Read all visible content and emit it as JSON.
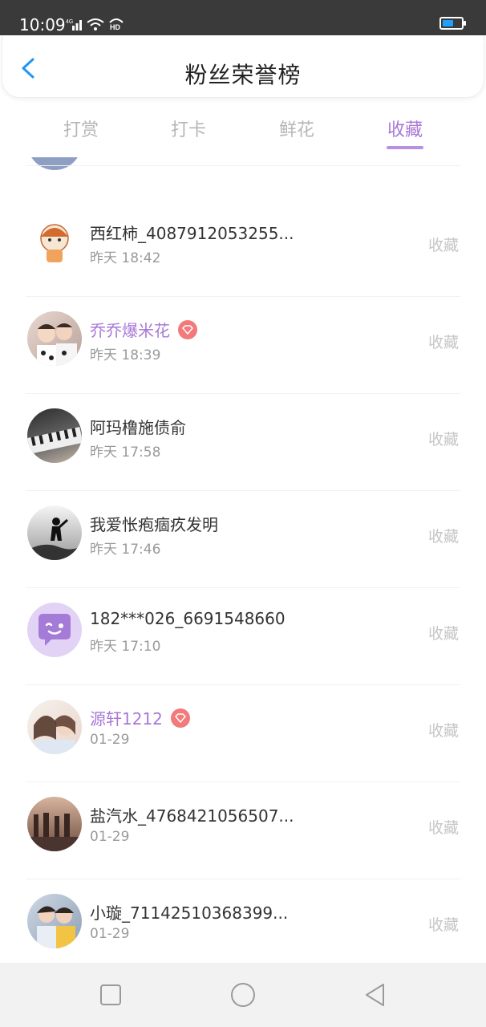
{
  "status": {
    "time": "10:09",
    "network": "4G",
    "hd": "HD"
  },
  "header": {
    "title": "粉丝荣誉榜"
  },
  "tabs": [
    "打赏",
    "打卡",
    "鲜花",
    "收藏"
  ],
  "active_tab": "收藏",
  "rows": [
    {
      "name": "西红柿_4087912053255...",
      "time": "昨天 18:42",
      "action": "收藏",
      "vip": false
    },
    {
      "name": "乔乔爆米花",
      "time": "昨天 18:39",
      "action": "收藏",
      "vip": true
    },
    {
      "name": "阿玛橹施债俞",
      "time": "昨天 17:58",
      "action": "收藏",
      "vip": false
    },
    {
      "name": "我爱怅疱痼疚发明",
      "time": "昨天 17:46",
      "action": "收藏",
      "vip": false
    },
    {
      "name": "182***026_6691548660",
      "time": "昨天 17:10",
      "action": "收藏",
      "vip": false
    },
    {
      "name": "源轩1212",
      "time": "01-29",
      "action": "收藏",
      "vip": true
    },
    {
      "name": "盐汽水_4768421056507...",
      "time": "01-29",
      "action": "收藏",
      "vip": false
    },
    {
      "name": "小璇_71142510368399...",
      "time": "01-29",
      "action": "收藏",
      "vip": false
    }
  ],
  "colors": {
    "accent": "#a978d6",
    "back_icon": "#2196f3",
    "vip_gem": "#f27a7a"
  }
}
